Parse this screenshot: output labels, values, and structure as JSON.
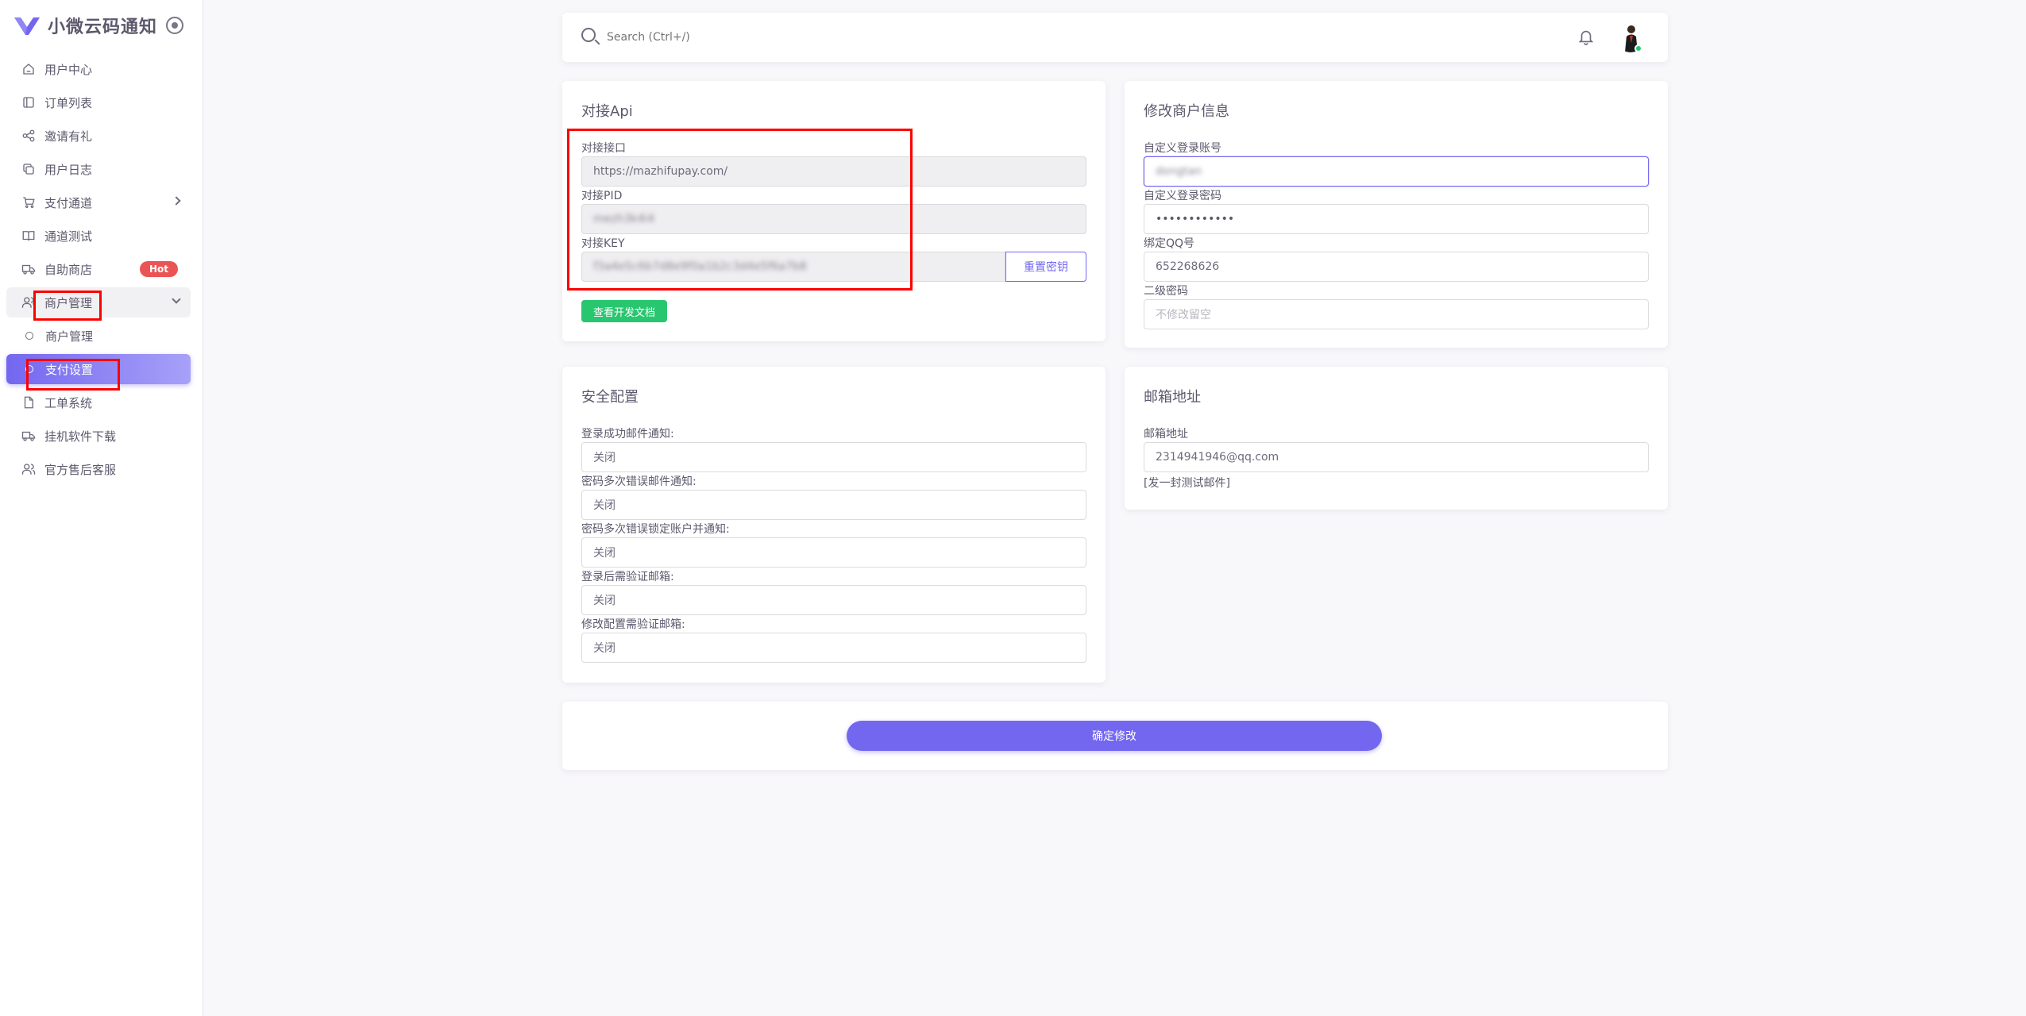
{
  "app": {
    "brand": "小微云码通知",
    "accent": "#7367f0"
  },
  "sidebar": {
    "items": [
      {
        "label": "用户中心",
        "icon": "home-icon"
      },
      {
        "label": "订单列表",
        "icon": "layout-icon"
      },
      {
        "label": "邀请有礼",
        "icon": "share-icon"
      },
      {
        "label": "用户日志",
        "icon": "copy-icon"
      },
      {
        "label": "支付通道",
        "icon": "cart-icon"
      },
      {
        "label": "通道测试",
        "icon": "book-icon"
      },
      {
        "label": "自助商店",
        "icon": "truck-icon",
        "badge": "Hot"
      },
      {
        "label": "商户管理",
        "icon": "users-icon"
      },
      {
        "label": "商户管理",
        "icon": "circle-icon"
      },
      {
        "label": "支付设置",
        "icon": "circle-icon"
      },
      {
        "label": "工单系统",
        "icon": "file-icon"
      },
      {
        "label": "挂机软件下载",
        "icon": "truck-icon"
      },
      {
        "label": "官方售后客服",
        "icon": "users-icon"
      }
    ]
  },
  "header": {
    "search_placeholder": "Search (Ctrl+/)"
  },
  "api_card": {
    "title": "对接Api",
    "endpoint_label": "对接接口",
    "endpoint_value": "https://mazhifupay.com/",
    "pid_label": "对接PID",
    "pid_value": "mezh3k4i4",
    "key_label": "对接KEY",
    "key_value": "f3a4e5c6b7d8e9f0a1b2c3d4e5f6a7b8",
    "reset_key_button": "重置密钥",
    "docs_button": "查看开发文档"
  },
  "merchant_card": {
    "title": "修改商户信息",
    "login_account_label": "自定义登录账号",
    "login_account_value": "dongtan",
    "login_password_label": "自定义登录密码",
    "login_password_value": "••••••••••••",
    "qq_label": "绑定QQ号",
    "qq_value": "652268626",
    "second_password_label": "二级密码",
    "second_password_placeholder": "不修改留空"
  },
  "security_card": {
    "title": "安全配置",
    "fields": [
      {
        "label": "登录成功邮件通知:",
        "value": "关闭"
      },
      {
        "label": "密码多次错误邮件通知:",
        "value": "关闭"
      },
      {
        "label": "密码多次错误锁定账户并通知:",
        "value": "关闭"
      },
      {
        "label": "登录后需验证邮箱:",
        "value": "关闭"
      },
      {
        "label": "修改配置需验证邮箱:",
        "value": "关闭"
      }
    ]
  },
  "email_card": {
    "title": "邮箱地址",
    "email_label": "邮箱地址",
    "email_value": "2314941946@qq.com",
    "test_link": "[发一封测试邮件]"
  },
  "submit": {
    "label": "确定修改"
  }
}
